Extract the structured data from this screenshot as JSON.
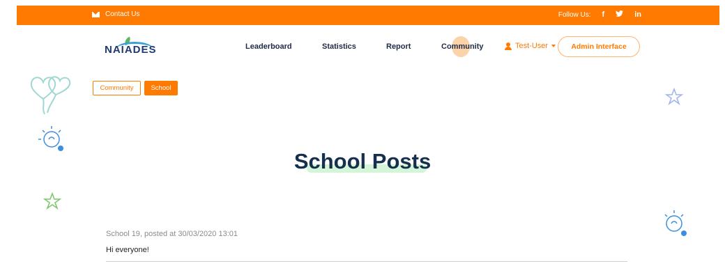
{
  "topbar": {
    "contact_label": "Contact Us",
    "follow_label": "Follow Us:",
    "social": [
      "f",
      "in"
    ]
  },
  "header": {
    "logo_text": "NAIADES",
    "nav": {
      "leaderboard": "Leaderboard",
      "statistics": "Statistics",
      "report": "Report",
      "community": "Community"
    },
    "user_label": "Test-User",
    "admin_button": "Admin Interface"
  },
  "tabs": {
    "community": "Community",
    "school": "School"
  },
  "page": {
    "title": "School Posts"
  },
  "post": {
    "meta": "School 19, posted at 30/03/2020 13:01",
    "body": "Hi everyone!"
  },
  "colors": {
    "accent": "#ff7a00",
    "title": "#14304d",
    "highlight": "#d6f5d8"
  }
}
